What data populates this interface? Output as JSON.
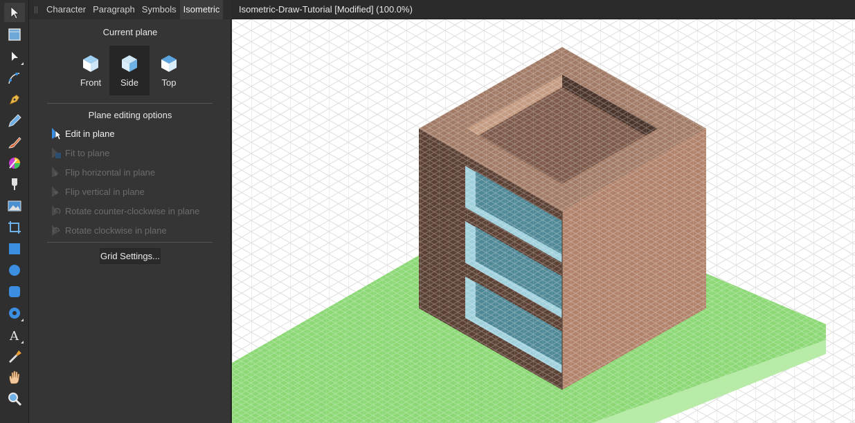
{
  "tabs": [
    {
      "label": "Character"
    },
    {
      "label": "Paragraph"
    },
    {
      "label": "Symbols"
    },
    {
      "label": "Isometric",
      "active": true
    }
  ],
  "panel": {
    "current_plane_title": "Current plane",
    "planes": [
      {
        "label": "Front",
        "active": false
      },
      {
        "label": "Side",
        "active": true
      },
      {
        "label": "Top",
        "active": false
      }
    ],
    "plane_editing_title": "Plane editing options",
    "options": [
      {
        "label": "Edit in plane",
        "enabled": true
      },
      {
        "label": "Fit to plane",
        "enabled": false
      },
      {
        "label": "Flip horizontal in plane",
        "enabled": false
      },
      {
        "label": "Flip vertical in plane",
        "enabled": false
      },
      {
        "label": "Rotate counter-clockwise in plane",
        "enabled": false
      },
      {
        "label": "Rotate clockwise in plane",
        "enabled": false
      }
    ],
    "grid_settings_label": "Grid Settings..."
  },
  "document": {
    "title": "Isometric-Draw-Tutorial [Modified] (100.0%)"
  },
  "tools": [
    {
      "icon": "move-tool-icon"
    },
    {
      "icon": "artboard-tool-icon"
    },
    {
      "icon": "node-tool-icon"
    },
    {
      "icon": "corner-tool-icon"
    },
    {
      "icon": "pen-tool-icon"
    },
    {
      "icon": "pencil-tool-icon"
    },
    {
      "icon": "vector-brush-tool-icon"
    },
    {
      "icon": "fill-tool-icon"
    },
    {
      "icon": "transparency-tool-icon"
    },
    {
      "icon": "place-image-tool-icon"
    },
    {
      "icon": "crop-tool-icon"
    },
    {
      "icon": "rectangle-tool-icon"
    },
    {
      "icon": "ellipse-tool-icon"
    },
    {
      "icon": "rounded-rectangle-tool-icon"
    },
    {
      "icon": "donut-tool-icon"
    },
    {
      "icon": "text-tool-icon"
    },
    {
      "icon": "color-picker-tool-icon"
    },
    {
      "icon": "view-tool-icon"
    },
    {
      "icon": "zoom-tool-icon"
    }
  ],
  "colors": {
    "cube_top": "#9fd0f2",
    "cube_front": "#ffffff",
    "cube_side": "#cfe6f7",
    "roof": "#a27b66",
    "roof_inner": "#7d5a4a",
    "wall_left": "#5b4034",
    "wall_right": "#b1826a",
    "window": "#4f8896",
    "window_frame": "#9fd0dc",
    "ground": "#8bd875",
    "ground_edge": "#b8eaa8",
    "grid_line": "#dedede",
    "accent": "#3b8ee0"
  }
}
